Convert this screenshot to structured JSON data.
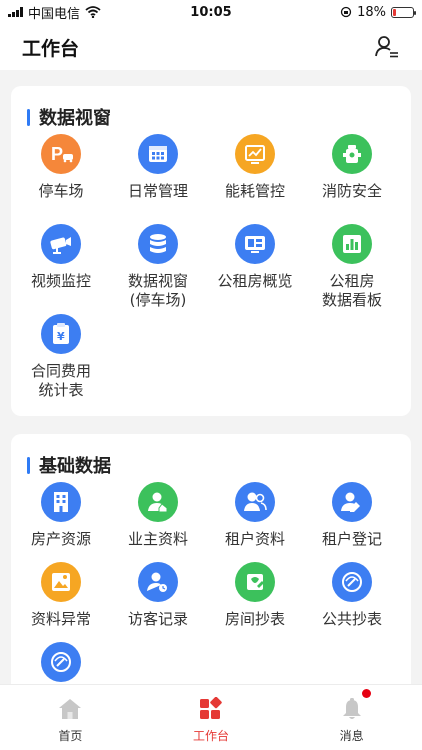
{
  "status_bar": {
    "carrier": "中国电信",
    "time": "10:05",
    "battery": "18%",
    "battery_level": 0.18
  },
  "header": {
    "title": "工作台",
    "user_icon": "user-list-icon"
  },
  "sections": [
    {
      "title": "数据视窗",
      "items": [
        {
          "label": "停车场",
          "icon": "parking-icon",
          "color": "#f5873a"
        },
        {
          "label": "日常管理",
          "icon": "calendar-icon",
          "color": "#3d7ef2"
        },
        {
          "label": "能耗管控",
          "icon": "chart-board-icon",
          "color": "#f6a623"
        },
        {
          "label": "消防安全",
          "icon": "hydrant-icon",
          "color": "#3cc15c"
        },
        {
          "label": "视频监控",
          "icon": "camera-icon",
          "color": "#3d7ef2"
        },
        {
          "label": "数据视窗\n(停车场)",
          "icon": "database-icon",
          "color": "#3d7ef2"
        },
        {
          "label": "公租房概览",
          "icon": "monitor-icon",
          "color": "#3d7ef2"
        },
        {
          "label": "公租房\n数据看板",
          "icon": "bar-chart-icon",
          "color": "#3cc15c"
        },
        {
          "label": "合同费用\n统计表",
          "icon": "clipboard-yen-icon",
          "color": "#3d7ef2"
        }
      ]
    },
    {
      "title": "基础数据",
      "items": [
        {
          "label": "房产资源",
          "icon": "building-icon",
          "color": "#3d7ef2"
        },
        {
          "label": "业主资料",
          "icon": "owner-icon",
          "color": "#3cc15c"
        },
        {
          "label": "租户资料",
          "icon": "tenants-icon",
          "color": "#3d7ef2"
        },
        {
          "label": "租户登记",
          "icon": "user-edit-icon",
          "color": "#3d7ef2"
        },
        {
          "label": "资料异常",
          "icon": "image-alert-icon",
          "color": "#f6a623"
        },
        {
          "label": "访客记录",
          "icon": "visitor-icon",
          "color": "#3d7ef2"
        },
        {
          "label": "房间抄表",
          "icon": "meter-edit-icon",
          "color": "#3cc15c"
        },
        {
          "label": "公共抄表",
          "icon": "meter-icon",
          "color": "#3d7ef2"
        },
        {
          "label": "",
          "icon": "meter-icon",
          "color": "#3d7ef2"
        }
      ]
    }
  ],
  "tabbar": [
    {
      "label": "首页",
      "icon": "home-icon",
      "active": false
    },
    {
      "label": "工作台",
      "icon": "workbench-icon",
      "active": true
    },
    {
      "label": "消息",
      "icon": "bell-icon",
      "active": false,
      "badge": true
    }
  ],
  "colors": {
    "accent": "#2f7bf5",
    "active_tab": "#e53935",
    "badge": "#e60012"
  }
}
